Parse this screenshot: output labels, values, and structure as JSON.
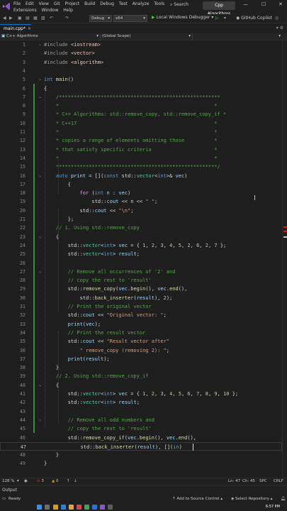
{
  "menu": {
    "row1": [
      "File",
      "Edit",
      "View",
      "Git",
      "Project",
      "Build",
      "Debug",
      "Test",
      "Analyze",
      "Tools"
    ],
    "row2": [
      "Extensions",
      "Window",
      "Help"
    ],
    "search_label": "Search",
    "project_name": "Cpp Algorithms"
  },
  "toolbar": {
    "config": "Debug",
    "platform": "x64",
    "run_label": "Local Windows Debugger",
    "copilot_label": "GitHub Copilot"
  },
  "tabs": [
    {
      "label": "main.cpp*",
      "active": true
    }
  ],
  "navbar": {
    "project": "C++ Algorithms",
    "scope": "(Global Scope)"
  },
  "editor": {
    "current_line": 47,
    "lines": [
      {
        "n": 1,
        "tokens": [
          {
            "t": "#include ",
            "c": "#9b9b9b"
          },
          {
            "t": "<iostream>",
            "c": "#e8c9bb"
          }
        ]
      },
      {
        "n": 2,
        "tokens": [
          {
            "t": "#include ",
            "c": "#9b9b9b"
          },
          {
            "t": "<vector>",
            "c": "#e8c9bb"
          }
        ]
      },
      {
        "n": 3,
        "tokens": [
          {
            "t": "#include ",
            "c": "#9b9b9b"
          },
          {
            "t": "<algorithm>",
            "c": "#e8c9bb"
          }
        ]
      },
      {
        "n": 4,
        "tokens": []
      },
      {
        "n": 5,
        "tokens": [
          {
            "t": "int ",
            "c": "#569cd6"
          },
          {
            "t": "main",
            "c": "#dcdcaa"
          },
          {
            "t": "()",
            "c": "#dcdcdc"
          }
        ]
      },
      {
        "n": 6,
        "tokens": [
          {
            "t": "{",
            "c": "#dcdcdc"
          }
        ]
      },
      {
        "n": 7,
        "tokens": [
          {
            "t": "    /******************************************************",
            "c": "#57a64a"
          }
        ]
      },
      {
        "n": 8,
        "tokens": [
          {
            "t": "    *                                                    *",
            "c": "#57a64a"
          }
        ]
      },
      {
        "n": 9,
        "tokens": [
          {
            "t": "    * C++ Algorithms: std::remove_copy, std::remove_copy_if *",
            "c": "#57a64a"
          }
        ]
      },
      {
        "n": 10,
        "tokens": [
          {
            "t": "    * C++17                                              *",
            "c": "#57a64a"
          }
        ]
      },
      {
        "n": 11,
        "tokens": [
          {
            "t": "    *                                                    *",
            "c": "#57a64a"
          }
        ]
      },
      {
        "n": 12,
        "tokens": [
          {
            "t": "    * copies a range of elements omitting those          *",
            "c": "#57a64a"
          }
        ]
      },
      {
        "n": 13,
        "tokens": [
          {
            "t": "    * that satisfy specific criteria                     *",
            "c": "#57a64a"
          }
        ]
      },
      {
        "n": 14,
        "tokens": [
          {
            "t": "    *                                                    *",
            "c": "#57a64a"
          }
        ]
      },
      {
        "n": 15,
        "tokens": [
          {
            "t": "    ******************************************************/",
            "c": "#57a64a"
          }
        ]
      },
      {
        "n": 16,
        "tokens": [
          {
            "t": "    ",
            "c": "#dcdcdc"
          },
          {
            "t": "auto ",
            "c": "#569cd6"
          },
          {
            "t": "print",
            "c": "#9cdcfe"
          },
          {
            "t": " = [](",
            "c": "#dcdcdc"
          },
          {
            "t": "const ",
            "c": "#569cd6"
          },
          {
            "t": "std::",
            "c": "#dcdcdc"
          },
          {
            "t": "vector",
            "c": "#4ec9b0"
          },
          {
            "t": "<",
            "c": "#dcdcdc"
          },
          {
            "t": "int",
            "c": "#569cd6"
          },
          {
            "t": ">& ",
            "c": "#dcdcdc"
          },
          {
            "t": "vec",
            "c": "#9cdcfe"
          },
          {
            "t": ")",
            "c": "#dcdcdc"
          }
        ]
      },
      {
        "n": 17,
        "tokens": [
          {
            "t": "        {",
            "c": "#dcdcdc"
          }
        ]
      },
      {
        "n": 18,
        "tokens": [
          {
            "t": "            ",
            "c": "#dcdcdc"
          },
          {
            "t": "for ",
            "c": "#d8a0df"
          },
          {
            "t": "(",
            "c": "#dcdcdc"
          },
          {
            "t": "int ",
            "c": "#569cd6"
          },
          {
            "t": "n",
            "c": "#9cdcfe"
          },
          {
            "t": " : ",
            "c": "#dcdcdc"
          },
          {
            "t": "vec",
            "c": "#9cdcfe"
          },
          {
            "t": ")",
            "c": "#dcdcdc"
          }
        ]
      },
      {
        "n": 19,
        "tokens": [
          {
            "t": "                std::",
            "c": "#dcdcdc"
          },
          {
            "t": "cout",
            "c": "#9cdcfe"
          },
          {
            "t": " << ",
            "c": "#dcdcdc"
          },
          {
            "t": "n",
            "c": "#9cdcfe"
          },
          {
            "t": " << ",
            "c": "#dcdcdc"
          },
          {
            "t": "\" \"",
            "c": "#d69d85"
          },
          {
            "t": ";",
            "c": "#dcdcdc"
          }
        ]
      },
      {
        "n": 20,
        "tokens": [
          {
            "t": "            std::",
            "c": "#dcdcdc"
          },
          {
            "t": "cout",
            "c": "#9cdcfe"
          },
          {
            "t": " << ",
            "c": "#dcdcdc"
          },
          {
            "t": "\"\\n\"",
            "c": "#d69d85"
          },
          {
            "t": ";",
            "c": "#dcdcdc"
          }
        ]
      },
      {
        "n": 21,
        "tokens": [
          {
            "t": "        };",
            "c": "#dcdcdc"
          }
        ]
      },
      {
        "n": 22,
        "tokens": [
          {
            "t": "    // 1. Using std::remove_copy",
            "c": "#57a64a"
          }
        ]
      },
      {
        "n": 23,
        "tokens": [
          {
            "t": "    {",
            "c": "#dcdcdc"
          }
        ]
      },
      {
        "n": 24,
        "tokens": [
          {
            "t": "        std::",
            "c": "#dcdcdc"
          },
          {
            "t": "vector",
            "c": "#4ec9b0"
          },
          {
            "t": "<",
            "c": "#dcdcdc"
          },
          {
            "t": "int",
            "c": "#569cd6"
          },
          {
            "t": "> ",
            "c": "#dcdcdc"
          },
          {
            "t": "vec",
            "c": "#9cdcfe"
          },
          {
            "t": " = { ",
            "c": "#dcdcdc"
          },
          {
            "t": "1",
            "c": "#b5cea8"
          },
          {
            "t": ", ",
            "c": "#dcdcdc"
          },
          {
            "t": "2",
            "c": "#b5cea8"
          },
          {
            "t": ", ",
            "c": "#dcdcdc"
          },
          {
            "t": "3",
            "c": "#b5cea8"
          },
          {
            "t": ", ",
            "c": "#dcdcdc"
          },
          {
            "t": "4",
            "c": "#b5cea8"
          },
          {
            "t": ", ",
            "c": "#dcdcdc"
          },
          {
            "t": "5",
            "c": "#b5cea8"
          },
          {
            "t": ", ",
            "c": "#dcdcdc"
          },
          {
            "t": "2",
            "c": "#b5cea8"
          },
          {
            "t": ", ",
            "c": "#dcdcdc"
          },
          {
            "t": "6",
            "c": "#b5cea8"
          },
          {
            "t": ", ",
            "c": "#dcdcdc"
          },
          {
            "t": "2",
            "c": "#b5cea8"
          },
          {
            "t": ", ",
            "c": "#dcdcdc"
          },
          {
            "t": "7",
            "c": "#b5cea8"
          },
          {
            "t": " };",
            "c": "#dcdcdc"
          }
        ]
      },
      {
        "n": 25,
        "tokens": [
          {
            "t": "        std::",
            "c": "#dcdcdc"
          },
          {
            "t": "vector",
            "c": "#4ec9b0"
          },
          {
            "t": "<",
            "c": "#dcdcdc"
          },
          {
            "t": "int",
            "c": "#569cd6"
          },
          {
            "t": "> ",
            "c": "#dcdcdc"
          },
          {
            "t": "result",
            "c": "#9cdcfe"
          },
          {
            "t": ";",
            "c": "#dcdcdc"
          }
        ]
      },
      {
        "n": 26,
        "tokens": []
      },
      {
        "n": 27,
        "tokens": [
          {
            "t": "        // Remove all occurrences of '2' and",
            "c": "#57a64a"
          }
        ]
      },
      {
        "n": 28,
        "tokens": [
          {
            "t": "        // copy the rest to 'result'",
            "c": "#57a64a"
          }
        ]
      },
      {
        "n": 29,
        "tokens": [
          {
            "t": "        std::",
            "c": "#dcdcdc"
          },
          {
            "t": "remove_copy",
            "c": "#dcdcaa"
          },
          {
            "t": "(",
            "c": "#dcdcdc"
          },
          {
            "t": "vec",
            "c": "#9cdcfe"
          },
          {
            "t": ".",
            "c": "#dcdcdc"
          },
          {
            "t": "begin",
            "c": "#dcdcaa"
          },
          {
            "t": "(), ",
            "c": "#dcdcdc"
          },
          {
            "t": "vec",
            "c": "#9cdcfe"
          },
          {
            "t": ".",
            "c": "#dcdcdc"
          },
          {
            "t": "end",
            "c": "#dcdcaa"
          },
          {
            "t": "(),",
            "c": "#dcdcdc"
          }
        ]
      },
      {
        "n": 30,
        "tokens": [
          {
            "t": "            std::",
            "c": "#dcdcdc"
          },
          {
            "t": "back_inserter",
            "c": "#dcdcaa"
          },
          {
            "t": "(",
            "c": "#dcdcdc"
          },
          {
            "t": "result",
            "c": "#9cdcfe"
          },
          {
            "t": "), ",
            "c": "#dcdcdc"
          },
          {
            "t": "2",
            "c": "#b5cea8"
          },
          {
            "t": ");",
            "c": "#dcdcdc"
          }
        ]
      },
      {
        "n": 31,
        "tokens": [
          {
            "t": "        // Print the original vector",
            "c": "#57a64a"
          }
        ]
      },
      {
        "n": 32,
        "tokens": [
          {
            "t": "        std::",
            "c": "#dcdcdc"
          },
          {
            "t": "cout",
            "c": "#9cdcfe"
          },
          {
            "t": " << ",
            "c": "#dcdcdc"
          },
          {
            "t": "\"Original vector: \"",
            "c": "#d69d85"
          },
          {
            "t": ";",
            "c": "#dcdcdc"
          }
        ]
      },
      {
        "n": 33,
        "tokens": [
          {
            "t": "        ",
            "c": "#dcdcdc"
          },
          {
            "t": "print",
            "c": "#9cdcfe"
          },
          {
            "t": "(",
            "c": "#dcdcdc"
          },
          {
            "t": "vec",
            "c": "#9cdcfe"
          },
          {
            "t": ");",
            "c": "#dcdcdc"
          }
        ]
      },
      {
        "n": 34,
        "tokens": [
          {
            "t": "        // Print the result vector",
            "c": "#57a64a"
          }
        ]
      },
      {
        "n": 35,
        "tokens": [
          {
            "t": "        std::",
            "c": "#dcdcdc"
          },
          {
            "t": "cout",
            "c": "#9cdcfe"
          },
          {
            "t": " << ",
            "c": "#dcdcdc"
          },
          {
            "t": "\"Result vector after\"",
            "c": "#d69d85"
          }
        ]
      },
      {
        "n": 36,
        "tokens": [
          {
            "t": "            ",
            "c": "#dcdcdc"
          },
          {
            "t": "\" remove_copy (removing 2): \"",
            "c": "#d69d85"
          },
          {
            "t": ";",
            "c": "#dcdcdc"
          }
        ]
      },
      {
        "n": 37,
        "tokens": [
          {
            "t": "        ",
            "c": "#dcdcdc"
          },
          {
            "t": "print",
            "c": "#9cdcfe"
          },
          {
            "t": "(",
            "c": "#dcdcdc"
          },
          {
            "t": "result",
            "c": "#9cdcfe"
          },
          {
            "t": ");",
            "c": "#dcdcdc"
          }
        ]
      },
      {
        "n": 38,
        "tokens": [
          {
            "t": "    }",
            "c": "#dcdcdc"
          }
        ]
      },
      {
        "n": 39,
        "tokens": [
          {
            "t": "    // 2. Using std::remove_copy_if",
            "c": "#57a64a"
          }
        ]
      },
      {
        "n": 40,
        "tokens": [
          {
            "t": "    {",
            "c": "#dcdcdc"
          }
        ]
      },
      {
        "n": 41,
        "tokens": [
          {
            "t": "        std::",
            "c": "#dcdcdc"
          },
          {
            "t": "vector",
            "c": "#4ec9b0"
          },
          {
            "t": "<",
            "c": "#dcdcdc"
          },
          {
            "t": "int",
            "c": "#569cd6"
          },
          {
            "t": "> ",
            "c": "#dcdcdc"
          },
          {
            "t": "vec",
            "c": "#9cdcfe"
          },
          {
            "t": " = { ",
            "c": "#dcdcdc"
          },
          {
            "t": "1",
            "c": "#b5cea8"
          },
          {
            "t": ", ",
            "c": "#dcdcdc"
          },
          {
            "t": "2",
            "c": "#b5cea8"
          },
          {
            "t": ", ",
            "c": "#dcdcdc"
          },
          {
            "t": "3",
            "c": "#b5cea8"
          },
          {
            "t": ", ",
            "c": "#dcdcdc"
          },
          {
            "t": "4",
            "c": "#b5cea8"
          },
          {
            "t": ", ",
            "c": "#dcdcdc"
          },
          {
            "t": "5",
            "c": "#b5cea8"
          },
          {
            "t": ", ",
            "c": "#dcdcdc"
          },
          {
            "t": "6",
            "c": "#b5cea8"
          },
          {
            "t": ", ",
            "c": "#dcdcdc"
          },
          {
            "t": "7",
            "c": "#b5cea8"
          },
          {
            "t": ", ",
            "c": "#dcdcdc"
          },
          {
            "t": "8",
            "c": "#b5cea8"
          },
          {
            "t": ", ",
            "c": "#dcdcdc"
          },
          {
            "t": "9",
            "c": "#b5cea8"
          },
          {
            "t": ", ",
            "c": "#dcdcdc"
          },
          {
            "t": "10",
            "c": "#b5cea8"
          },
          {
            "t": " };",
            "c": "#dcdcdc"
          }
        ]
      },
      {
        "n": 42,
        "tokens": [
          {
            "t": "        std::",
            "c": "#dcdcdc"
          },
          {
            "t": "vector",
            "c": "#4ec9b0"
          },
          {
            "t": "<",
            "c": "#dcdcdc"
          },
          {
            "t": "int",
            "c": "#569cd6"
          },
          {
            "t": "> ",
            "c": "#dcdcdc"
          },
          {
            "t": "result",
            "c": "#9cdcfe"
          },
          {
            "t": ";",
            "c": "#dcdcdc"
          }
        ]
      },
      {
        "n": 43,
        "tokens": []
      },
      {
        "n": 44,
        "tokens": [
          {
            "t": "        // Remove all odd numbers and",
            "c": "#57a64a"
          }
        ]
      },
      {
        "n": 45,
        "tokens": [
          {
            "t": "        // copy the rest to 'result'",
            "c": "#57a64a"
          }
        ]
      },
      {
        "n": 46,
        "tokens": [
          {
            "t": "        std::",
            "c": "#dcdcdc"
          },
          {
            "t": "remove_copy_if",
            "c": "#dcdcaa"
          },
          {
            "t": "(",
            "c": "#dcdcdc"
          },
          {
            "t": "vec",
            "c": "#9cdcfe"
          },
          {
            "t": ".",
            "c": "#dcdcdc"
          },
          {
            "t": "begin",
            "c": "#dcdcaa"
          },
          {
            "t": "(), ",
            "c": "#dcdcdc"
          },
          {
            "t": "vec",
            "c": "#9cdcfe"
          },
          {
            "t": ".",
            "c": "#dcdcdc"
          },
          {
            "t": "end",
            "c": "#dcdcaa"
          },
          {
            "t": "(),",
            "c": "#dcdcdc"
          }
        ]
      },
      {
        "n": 47,
        "tokens": [
          {
            "t": "            std::",
            "c": "#dcdcdc"
          },
          {
            "t": "back_inserter",
            "c": "#dcdcaa"
          },
          {
            "t": "(",
            "c": "#dcdcdc"
          },
          {
            "t": "result",
            "c": "#9cdcfe"
          },
          {
            "t": "), [](",
            "c": "#dcdcdc"
          },
          {
            "t": "in",
            "c": "#569cd6"
          },
          {
            "t": ")",
            "c": "#dcdcdc"
          }
        ]
      },
      {
        "n": 48,
        "tokens": [
          {
            "t": "    }",
            "c": "#dcdcdc"
          }
        ]
      },
      {
        "n": 49,
        "tokens": [
          {
            "t": "}",
            "c": "#dcdcdc"
          }
        ]
      }
    ]
  },
  "bottombar": {
    "zoom": "128 %",
    "errors": "3",
    "warnings": "0",
    "line": "Ln: 47",
    "col": "Ch: 45",
    "spc": "SPC",
    "crlf": "CRLF"
  },
  "output_panel": {
    "label": "Output"
  },
  "statusbar": {
    "ready": "Ready",
    "source_control": "Add to Source Control",
    "repository": "Select Repository"
  },
  "taskbar": {
    "time": "6:57 PM"
  },
  "colors": {
    "accent": "#0078d4",
    "run": "#4ec94e",
    "error": "#e51400",
    "warning": "#cca700",
    "change_bar": "#3a8c3a"
  }
}
